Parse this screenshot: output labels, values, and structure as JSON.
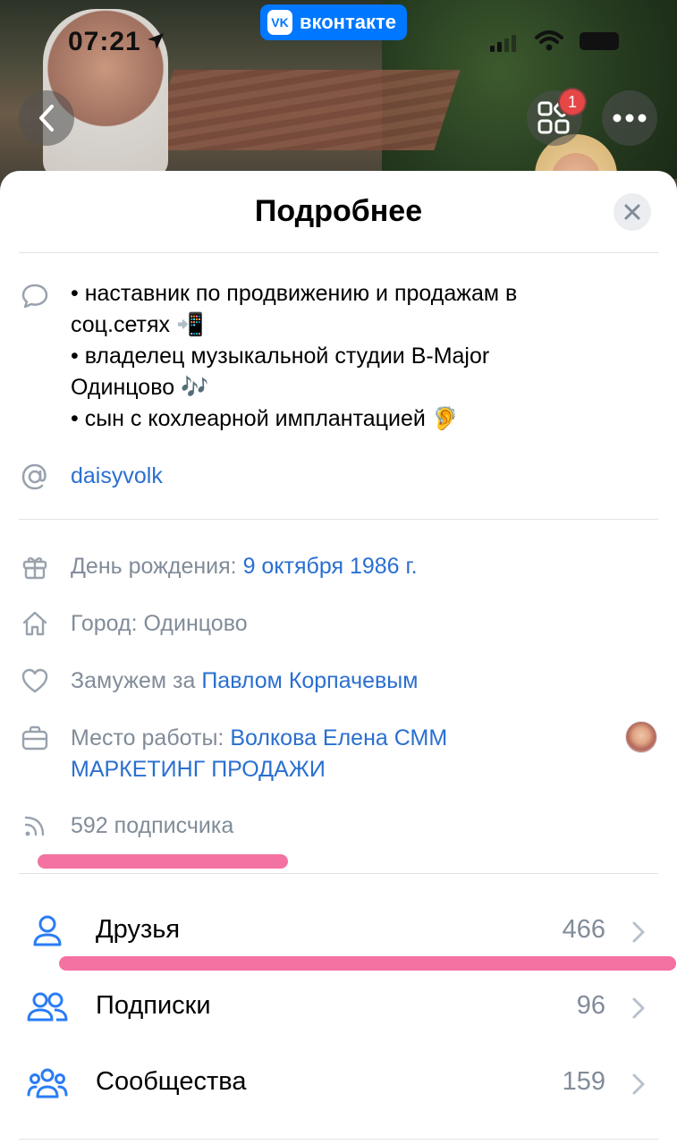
{
  "status_bar": {
    "time": "07:21"
  },
  "header": {
    "app_badge_label": "вконтакте",
    "apps_badge_count": "1"
  },
  "sheet": {
    "title": "Подробнее",
    "status": {
      "line1": "• наставник по продвижению и продажам в",
      "line2": "соц.сетях 📲",
      "line3": "• владелец музыкальной студии B-Major",
      "line4": "Одинцово 🎶",
      "line5": "• сын с кохлеарной имплантацией 🦻"
    },
    "nickname": "daisyvolk",
    "birthday": {
      "label": "День рождения: ",
      "value": "9 октября 1986 г."
    },
    "city": {
      "label": "Город: Одинцово"
    },
    "relationship": {
      "label": "Замужем за ",
      "value": "Павлом Корпачевым"
    },
    "work": {
      "label": "Место работы: ",
      "value_line1": "Волкова Елена СММ",
      "value_line2": "МАРКЕТИНГ ПРОДАЖИ"
    },
    "followers": "592 подписчика",
    "rows": [
      {
        "label": "Друзья",
        "count": "466"
      },
      {
        "label": "Подписки",
        "count": "96"
      },
      {
        "label": "Сообщества",
        "count": "159"
      }
    ]
  },
  "colors": {
    "accent": "#0077ff",
    "link": "#2a6fd0",
    "secondary_text": "#818c99",
    "highlight": "#f26a9c",
    "badge": "#e64646"
  }
}
